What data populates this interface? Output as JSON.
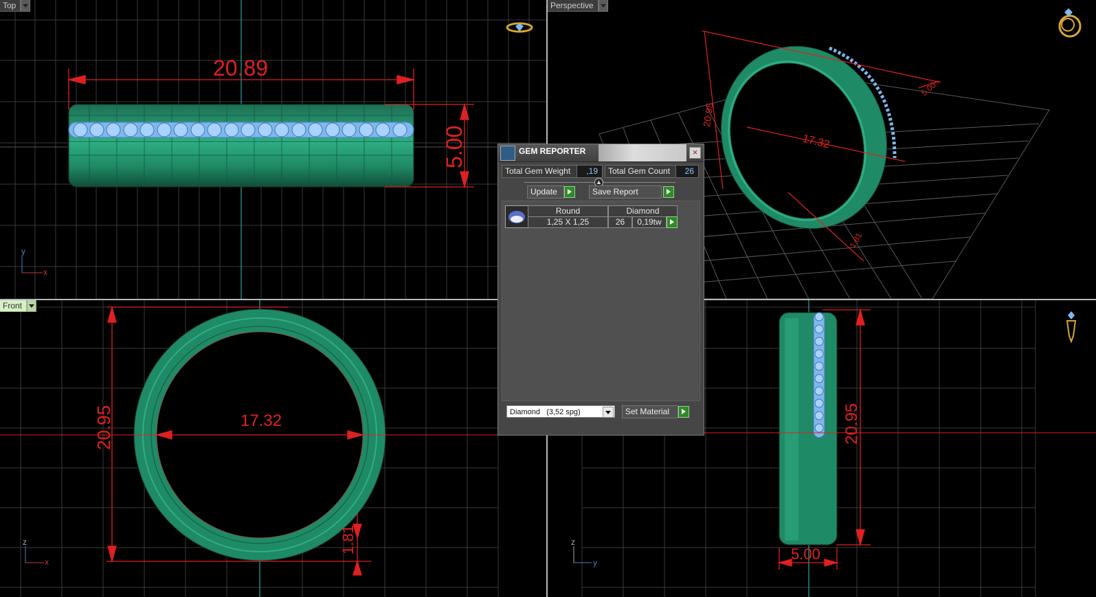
{
  "viewports": {
    "top": {
      "label": "Top",
      "axis_a": "y",
      "axis_b": "x",
      "dims": [
        "20.89",
        "5.00"
      ]
    },
    "perspective": {
      "label": "Perspective",
      "dims": [
        "20.95",
        "17.32",
        "5.00",
        "1.81"
      ]
    },
    "front": {
      "label": "Front",
      "axis_a": "z",
      "axis_b": "x",
      "dims": [
        "20.95",
        "17.32",
        "1.81"
      ]
    },
    "right": {
      "axis_a": "z",
      "axis_b": "y",
      "dims": [
        "20.95",
        "5.00"
      ]
    }
  },
  "gem_reporter": {
    "title": "GEM REPORTER",
    "total_weight_label": "Total Gem Weight",
    "total_weight_value": ",19",
    "total_count_label": "Total Gem Count",
    "total_count_value": "26",
    "update_label": "Update",
    "save_label": "Save Report",
    "gems": [
      {
        "shape": "Round",
        "material": "Diamond",
        "size": "1,25 X 1,25",
        "count": "26",
        "weight": "0,19tw"
      }
    ],
    "material_select": "Diamond   (3,52 spg)",
    "set_material_label": "Set Material"
  },
  "colors": {
    "ring": "#1f8a66",
    "gem": "#7fb8ee",
    "dimension": "#e02020",
    "grid": "#3c3c3c",
    "axis": "#2aa7a7"
  },
  "icons": [
    "ring-view-icon",
    "ring-perspective-icon",
    "ring-side-icon",
    "gem-icon",
    "close-icon",
    "go-arrow-icon",
    "dropdown-arrow-icon"
  ]
}
